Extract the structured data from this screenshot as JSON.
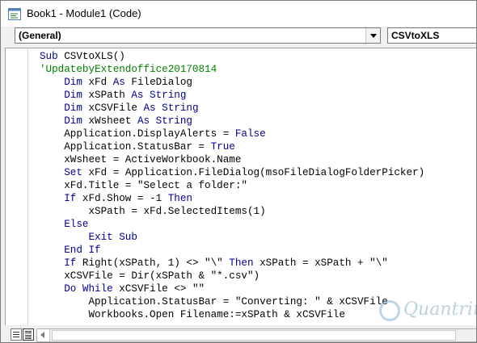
{
  "window": {
    "title": "Book1 - Module1 (Code)"
  },
  "object_dropdown": {
    "value": "(General)"
  },
  "procedure_dropdown": {
    "value": "CSVtoXLS"
  },
  "code_lines": [
    [
      {
        "t": "Sub ",
        "c": "kw"
      },
      {
        "t": "CSVtoXLS()",
        "c": ""
      }
    ],
    [
      {
        "t": "'UpdatebyExtendoffice20170814",
        "c": "cm"
      }
    ],
    [
      {
        "t": "    Dim ",
        "c": "kw"
      },
      {
        "t": "xFd ",
        "c": ""
      },
      {
        "t": "As ",
        "c": "kw"
      },
      {
        "t": "FileDialog",
        "c": ""
      }
    ],
    [
      {
        "t": "    Dim ",
        "c": "kw"
      },
      {
        "t": "xSPath ",
        "c": ""
      },
      {
        "t": "As String",
        "c": "kw"
      }
    ],
    [
      {
        "t": "    Dim ",
        "c": "kw"
      },
      {
        "t": "xCSVFile ",
        "c": ""
      },
      {
        "t": "As String",
        "c": "kw"
      }
    ],
    [
      {
        "t": "    Dim ",
        "c": "kw"
      },
      {
        "t": "xWsheet ",
        "c": ""
      },
      {
        "t": "As String",
        "c": "kw"
      }
    ],
    [
      {
        "t": "    Application.DisplayAlerts = ",
        "c": ""
      },
      {
        "t": "False",
        "c": "kw"
      }
    ],
    [
      {
        "t": "    Application.StatusBar = ",
        "c": ""
      },
      {
        "t": "True",
        "c": "kw"
      }
    ],
    [
      {
        "t": "    xWsheet = ActiveWorkbook.Name",
        "c": ""
      }
    ],
    [
      {
        "t": "    Set ",
        "c": "kw"
      },
      {
        "t": "xFd = Application.FileDialog(msoFileDialogFolderPicker)",
        "c": ""
      }
    ],
    [
      {
        "t": "    xFd.Title = \"Select a folder:\"",
        "c": ""
      }
    ],
    [
      {
        "t": "    If ",
        "c": "kw"
      },
      {
        "t": "xFd.Show = -1 ",
        "c": ""
      },
      {
        "t": "Then",
        "c": "kw"
      }
    ],
    [
      {
        "t": "        xSPath = xFd.SelectedItems(1)",
        "c": ""
      }
    ],
    [
      {
        "t": "    Else",
        "c": "kw"
      }
    ],
    [
      {
        "t": "        Exit Sub",
        "c": "kw"
      }
    ],
    [
      {
        "t": "    End If",
        "c": "kw"
      }
    ],
    [
      {
        "t": "    If ",
        "c": "kw"
      },
      {
        "t": "Right(xSPath, 1) <> \"\\\" ",
        "c": ""
      },
      {
        "t": "Then ",
        "c": "kw"
      },
      {
        "t": "xSPath = xSPath + \"\\\"",
        "c": ""
      }
    ],
    [
      {
        "t": "    xCSVFile = Dir(xSPath & \"*.csv\")",
        "c": ""
      }
    ],
    [
      {
        "t": "    Do While ",
        "c": "kw"
      },
      {
        "t": "xCSVFile <> \"\"",
        "c": ""
      }
    ],
    [
      {
        "t": "        Application.StatusBar = \"Converting: \" & xCSVFile",
        "c": ""
      }
    ],
    [
      {
        "t": "        Workbooks.Open Filename:=xSPath & xCSVFile",
        "c": ""
      }
    ]
  ],
  "colors": {
    "keyword": "#00008b",
    "comment": "#008000"
  },
  "watermark": {
    "text": "Quantrimang"
  }
}
